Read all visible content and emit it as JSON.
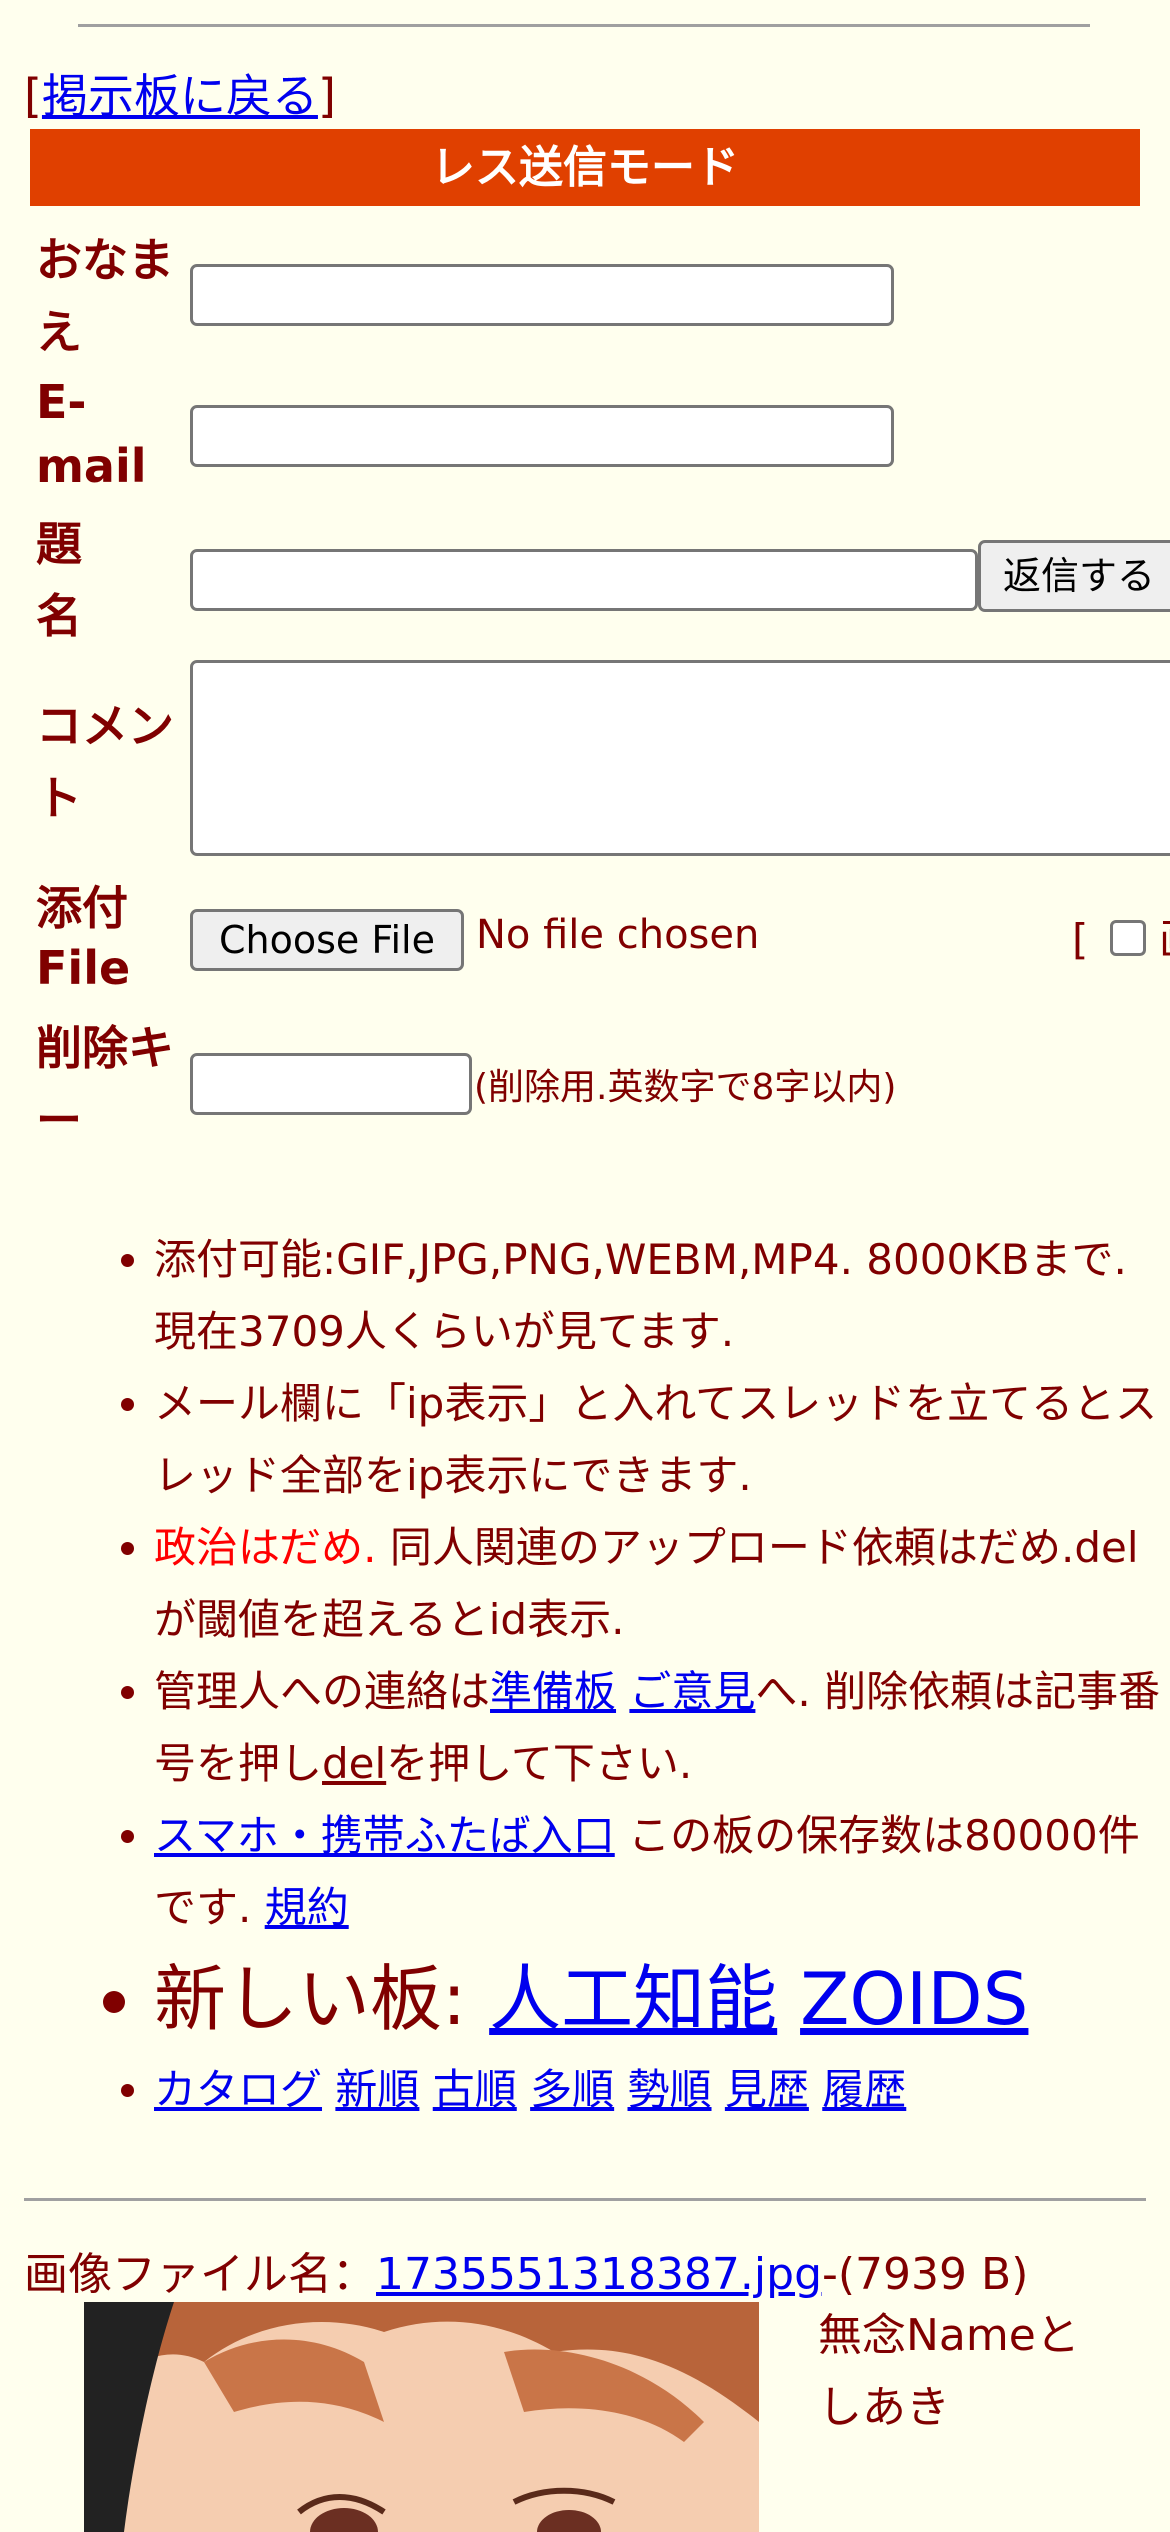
{
  "nav": {
    "back_open": "[",
    "back_label": "掲示板に戻る",
    "back_close": "]"
  },
  "form": {
    "title": "レス送信モード",
    "name_label_1": "おなま",
    "name_label_2": "え",
    "email_label_1": "E-",
    "email_label_2": "mail",
    "subject_label_1": "題",
    "subject_label_2": "名",
    "submit_label": "返信する",
    "comment_label_1": "コメン",
    "comment_label_2": "ト",
    "file_label_1": "添付",
    "file_label_2": "File",
    "choose_file_label": "Choose File",
    "no_file_text": "No file chosen",
    "image_option_prefix": "[",
    "image_option_label": "画",
    "delkey_label_1": "削除キ",
    "delkey_label_2": "ー",
    "delkey_note": "(削除用.英数字で8字以内)"
  },
  "rules": {
    "r1": "添付可能:GIF,JPG,PNG,WEBM,MP4. 8000KBまで. 現在3709人くらいが見てます.",
    "r2": "メール欄に「ip表示」と入れてスレッドを立てるとスレッド全部をip表示にできます.",
    "r3_red": "政治はだめ.",
    "r3_rest": " 同人関連のアップロード依頼はだめ.delが閾値を超えるとid表示.",
    "r4_a": "管理人への連絡は",
    "r4_link1": "準備板",
    "r4_link2": "ご意見",
    "r4_b": "へ. 削除依頼は記事番号を押し",
    "r4_del": "del",
    "r4_c": "を押して下さい.",
    "r5_link": "スマホ・携帯ふたば入口",
    "r5_text": " この板の保存数は80000件です. ",
    "r5_terms": "規約",
    "r6_prefix": "新しい板: ",
    "r6_link1": "人工知能",
    "r6_link2": "ZOIDS",
    "r7_links": [
      "カタログ",
      "新順",
      "古順",
      "多順",
      "勢順",
      "見歴",
      "履歴"
    ]
  },
  "post": {
    "file_prefix": "画像ファイル名：",
    "file_name": "1735551318387.jpg",
    "file_size": "-(7939 B)",
    "name_1": "無念Nameと",
    "name_2": "しあき"
  },
  "colors": {
    "text": "#800000",
    "banner": "#E04000",
    "background": "#FFFFEE",
    "link": "#0000EE",
    "alert": "#FF0000"
  }
}
